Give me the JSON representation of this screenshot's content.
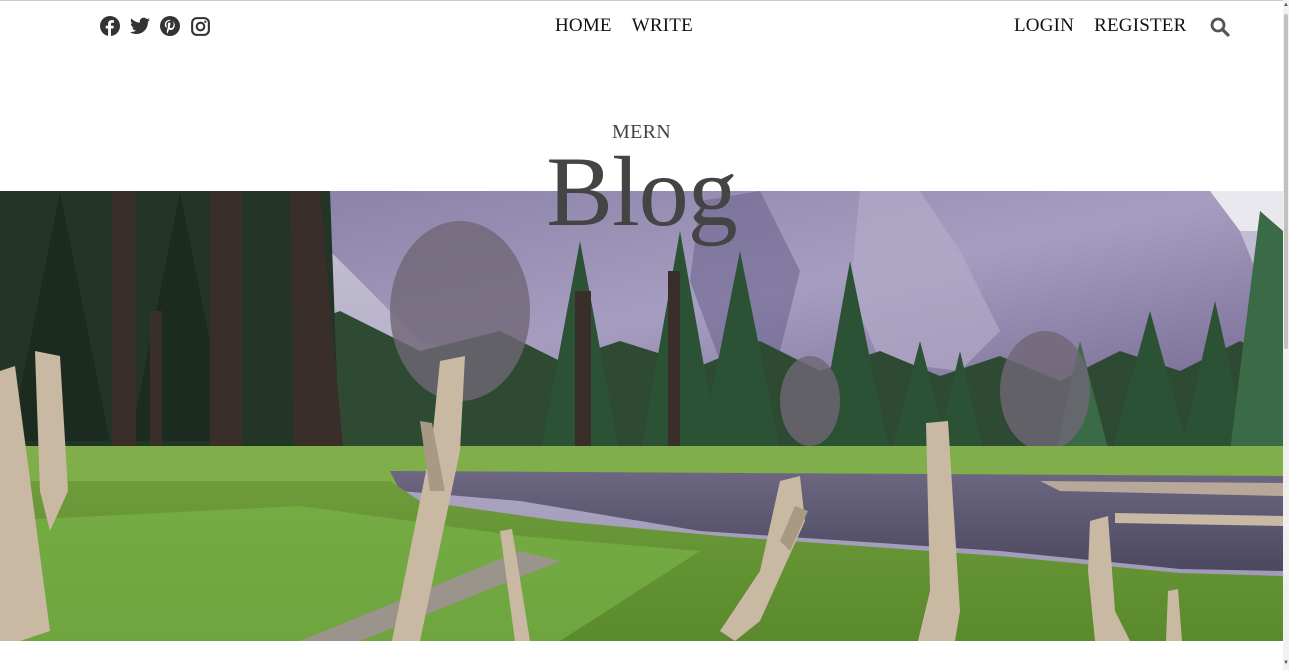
{
  "social": {
    "icons": [
      "facebook-icon",
      "twitter-icon",
      "pinterest-icon",
      "instagram-icon"
    ],
    "color": "#333333"
  },
  "nav": {
    "home": "HOME",
    "write": "WRITE",
    "login": "LOGIN",
    "register": "REGISTER",
    "search_icon": "search-icon"
  },
  "header": {
    "title_small": "MERN",
    "title_large": "Blog",
    "title_color": "#444444"
  },
  "hero": {
    "image": "header-landscape-image"
  }
}
